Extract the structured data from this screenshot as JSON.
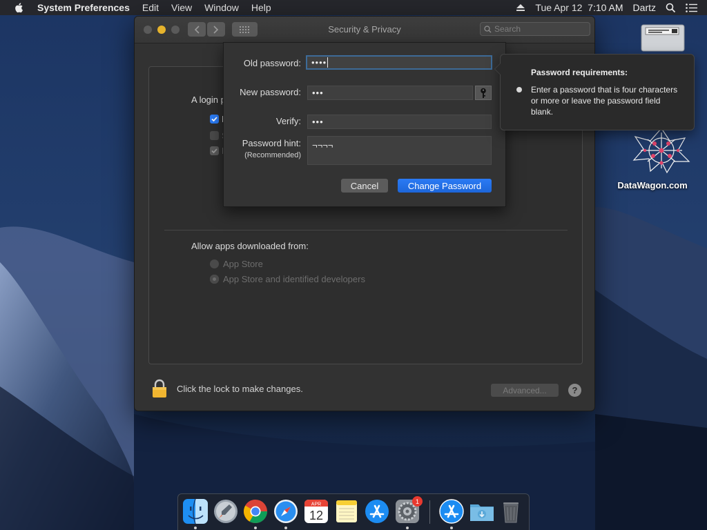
{
  "menubar": {
    "app_name": "System Preferences",
    "menus": [
      "Edit",
      "View",
      "Window",
      "Help"
    ],
    "datetime": "Tue Apr 12  7:10 AM",
    "user": "Dartz"
  },
  "window": {
    "title": "Security & Privacy",
    "search_placeholder": "Search",
    "general": {
      "login_label": "A login p",
      "checkbox_letters": [
        "R",
        "S",
        "D"
      ]
    },
    "allow_apps_label": "Allow apps downloaded from:",
    "radio_options": [
      "App Store",
      "App Store and identified developers"
    ],
    "lock_text": "Click the lock to make changes.",
    "advanced_label": "Advanced...",
    "help_label": "?"
  },
  "sheet": {
    "old_password_label": "Old password:",
    "old_password_value": "••••",
    "new_password_label": "New password:",
    "new_password_value": "•••",
    "verify_label": "Verify:",
    "verify_value": "•••",
    "hint_label": "Password hint:",
    "hint_sublabel": "(Recommended)",
    "hint_value": "¬¬¬¬",
    "cancel_label": "Cancel",
    "change_label": "Change Password"
  },
  "popover": {
    "title": "Password requirements:",
    "text": "Enter a password that is four characters or more or leave the password field blank."
  },
  "desktop": {
    "datawagon_label": "DataWagon.com"
  },
  "dock": {
    "calendar_month": "APR",
    "calendar_day": "12",
    "badge_count": "1"
  },
  "colors": {
    "accent_blue": "#2b7bf4",
    "traffic_red": "#5a5a5a",
    "traffic_yellow": "#e6b32c",
    "badge_red": "#e8392f"
  },
  "icons": {
    "apple": "apple-logo-icon",
    "eject": "eject-icon",
    "search": "magnifier-icon",
    "list": "list-icon",
    "lock": "lock-icon",
    "key": "key-icon"
  }
}
